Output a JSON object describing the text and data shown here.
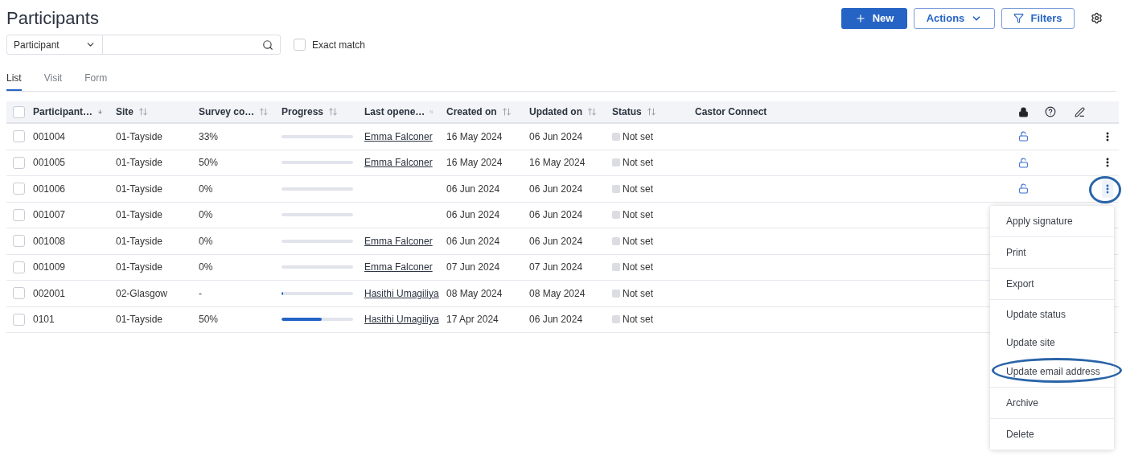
{
  "title": "Participants",
  "header_buttons": [
    {
      "kind": "primary",
      "label": "New"
    },
    {
      "kind": "dropdown",
      "label": "Actions"
    },
    {
      "kind": "filter",
      "label": "Filters"
    }
  ],
  "search": {
    "field_select": "Participant",
    "exact_match": {
      "label": "Exact match",
      "checked": false
    }
  },
  "tabs": [
    {
      "label": "List",
      "selected": true
    },
    {
      "label": "Visit",
      "selected": false
    },
    {
      "label": "Form",
      "selected": false
    }
  ],
  "table": {
    "all_checked": false,
    "columns": [
      {
        "label": "Participant…",
        "sortable": true,
        "sorted": true
      },
      {
        "label": "Site",
        "sortable": true,
        "sorted": false
      },
      {
        "label": "Survey co…",
        "sortable": true,
        "sorted": false
      },
      {
        "label": "Progress",
        "sortable": true,
        "sorted": false
      },
      {
        "label": "Last opene…",
        "sortable": true,
        "sorted": false
      },
      {
        "label": "Created on",
        "sortable": true,
        "sorted": false
      },
      {
        "label": "Updated on",
        "sortable": true,
        "sorted": false
      },
      {
        "label": "Status",
        "sortable": true,
        "sorted": false
      },
      {
        "label": "Castor Connect",
        "sortable": false,
        "sorted": false
      }
    ],
    "rows": [
      {
        "participant": "001004",
        "site": "01-Tayside",
        "survey": "33%",
        "level": 0,
        "last_opened": "Emma Falconer",
        "created": "16 May 2024",
        "updated": "06 Jun 2024",
        "status": "Not set",
        "unlocked": true,
        "menu_button": true,
        "menu_open": false,
        "checked": false
      },
      {
        "participant": "001005",
        "site": "01-Tayside",
        "survey": "50%",
        "level": 0,
        "last_opened": "Emma Falconer",
        "created": "16 May 2024",
        "updated": "16 May 2024",
        "status": "Not set",
        "unlocked": true,
        "menu_button": true,
        "menu_open": false,
        "checked": false
      },
      {
        "participant": "001006",
        "site": "01-Tayside",
        "survey": "0%",
        "level": 0,
        "created": "06 Jun 2024",
        "updated": "06 Jun 2024",
        "status": "Not set",
        "unlocked": true,
        "menu_button": true,
        "menu_open": true,
        "checked": false
      },
      {
        "participant": "001007",
        "site": "01-Tayside",
        "survey": "0%",
        "level": 0,
        "created": "06 Jun 2024",
        "updated": "06 Jun 2024",
        "status": "Not set",
        "unlocked": false,
        "menu_button": false,
        "checked": false
      },
      {
        "participant": "001008",
        "site": "01-Tayside",
        "survey": "0%",
        "level": 0,
        "last_opened": "Emma Falconer",
        "created": "06 Jun 2024",
        "updated": "06 Jun 2024",
        "status": "Not set",
        "unlocked": false,
        "menu_button": false,
        "checked": false
      },
      {
        "participant": "001009",
        "site": "01-Tayside",
        "survey": "0%",
        "level": 0,
        "last_opened": "Emma Falconer",
        "created": "07 Jun 2024",
        "updated": "07 Jun 2024",
        "status": "Not set",
        "unlocked": false,
        "menu_button": false,
        "checked": false
      },
      {
        "participant": "002001",
        "site": "02-Glasgow",
        "survey": "-",
        "level": 0.02,
        "last_opened": "Hasithi Umagiliya",
        "created": "08 May 2024",
        "updated": "08 May 2024",
        "status": "Not set",
        "unlocked": false,
        "menu_button": false,
        "checked": false
      },
      {
        "participant": "0101",
        "site": "01-Tayside",
        "survey": "50%",
        "level": 0.56,
        "last_opened": "Hasithi Umagiliya",
        "created": "17 Apr 2024",
        "updated": "06 Jun 2024",
        "status": "Not set",
        "unlocked": false,
        "menu_button": false,
        "checked": false
      }
    ]
  },
  "context_menu": {
    "items": [
      {
        "label": "Apply signature",
        "highlighted": false
      },
      {
        "label": "Print",
        "highlighted": false
      },
      {
        "label": "Export",
        "highlighted": false
      },
      {
        "label": "Update status",
        "highlighted": false
      },
      {
        "label": "Update site",
        "highlighted": false
      },
      {
        "label": "Update email address",
        "highlighted": true
      },
      {
        "label": "Archive",
        "highlighted": false
      },
      {
        "label": "Delete",
        "highlighted": false
      }
    ]
  }
}
